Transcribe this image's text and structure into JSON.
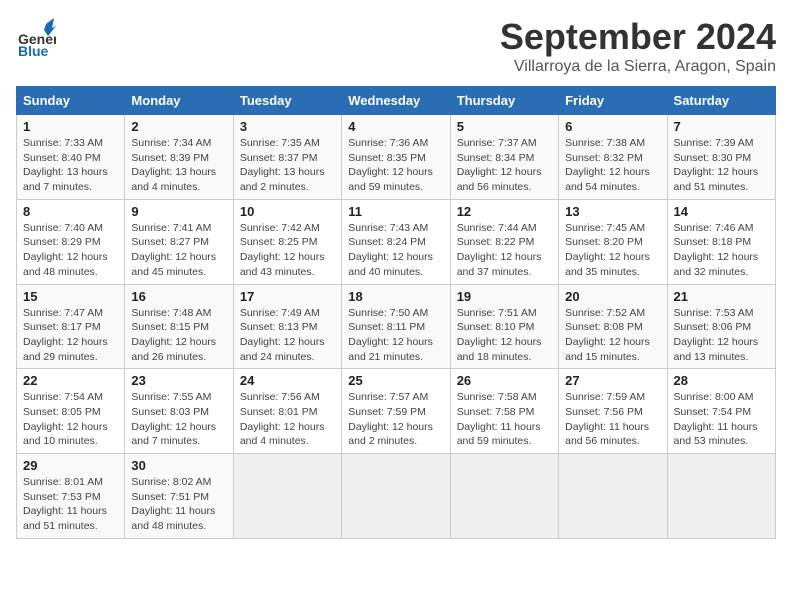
{
  "header": {
    "logo_line1": "General",
    "logo_line2": "Blue",
    "month_year": "September 2024",
    "location": "Villarroya de la Sierra, Aragon, Spain"
  },
  "days_of_week": [
    "Sunday",
    "Monday",
    "Tuesday",
    "Wednesday",
    "Thursday",
    "Friday",
    "Saturday"
  ],
  "weeks": [
    [
      {
        "day": 1,
        "sunrise": "7:33 AM",
        "sunset": "8:40 PM",
        "daylight": "13 hours and 7 minutes"
      },
      {
        "day": 2,
        "sunrise": "7:34 AM",
        "sunset": "8:39 PM",
        "daylight": "13 hours and 4 minutes"
      },
      {
        "day": 3,
        "sunrise": "7:35 AM",
        "sunset": "8:37 PM",
        "daylight": "13 hours and 2 minutes"
      },
      {
        "day": 4,
        "sunrise": "7:36 AM",
        "sunset": "8:35 PM",
        "daylight": "12 hours and 59 minutes"
      },
      {
        "day": 5,
        "sunrise": "7:37 AM",
        "sunset": "8:34 PM",
        "daylight": "12 hours and 56 minutes"
      },
      {
        "day": 6,
        "sunrise": "7:38 AM",
        "sunset": "8:32 PM",
        "daylight": "12 hours and 54 minutes"
      },
      {
        "day": 7,
        "sunrise": "7:39 AM",
        "sunset": "8:30 PM",
        "daylight": "12 hours and 51 minutes"
      }
    ],
    [
      {
        "day": 8,
        "sunrise": "7:40 AM",
        "sunset": "8:29 PM",
        "daylight": "12 hours and 48 minutes"
      },
      {
        "day": 9,
        "sunrise": "7:41 AM",
        "sunset": "8:27 PM",
        "daylight": "12 hours and 45 minutes"
      },
      {
        "day": 10,
        "sunrise": "7:42 AM",
        "sunset": "8:25 PM",
        "daylight": "12 hours and 43 minutes"
      },
      {
        "day": 11,
        "sunrise": "7:43 AM",
        "sunset": "8:24 PM",
        "daylight": "12 hours and 40 minutes"
      },
      {
        "day": 12,
        "sunrise": "7:44 AM",
        "sunset": "8:22 PM",
        "daylight": "12 hours and 37 minutes"
      },
      {
        "day": 13,
        "sunrise": "7:45 AM",
        "sunset": "8:20 PM",
        "daylight": "12 hours and 35 minutes"
      },
      {
        "day": 14,
        "sunrise": "7:46 AM",
        "sunset": "8:18 PM",
        "daylight": "12 hours and 32 minutes"
      }
    ],
    [
      {
        "day": 15,
        "sunrise": "7:47 AM",
        "sunset": "8:17 PM",
        "daylight": "12 hours and 29 minutes"
      },
      {
        "day": 16,
        "sunrise": "7:48 AM",
        "sunset": "8:15 PM",
        "daylight": "12 hours and 26 minutes"
      },
      {
        "day": 17,
        "sunrise": "7:49 AM",
        "sunset": "8:13 PM",
        "daylight": "12 hours and 24 minutes"
      },
      {
        "day": 18,
        "sunrise": "7:50 AM",
        "sunset": "8:11 PM",
        "daylight": "12 hours and 21 minutes"
      },
      {
        "day": 19,
        "sunrise": "7:51 AM",
        "sunset": "8:10 PM",
        "daylight": "12 hours and 18 minutes"
      },
      {
        "day": 20,
        "sunrise": "7:52 AM",
        "sunset": "8:08 PM",
        "daylight": "12 hours and 15 minutes"
      },
      {
        "day": 21,
        "sunrise": "7:53 AM",
        "sunset": "8:06 PM",
        "daylight": "12 hours and 13 minutes"
      }
    ],
    [
      {
        "day": 22,
        "sunrise": "7:54 AM",
        "sunset": "8:05 PM",
        "daylight": "12 hours and 10 minutes"
      },
      {
        "day": 23,
        "sunrise": "7:55 AM",
        "sunset": "8:03 PM",
        "daylight": "12 hours and 7 minutes"
      },
      {
        "day": 24,
        "sunrise": "7:56 AM",
        "sunset": "8:01 PM",
        "daylight": "12 hours and 4 minutes"
      },
      {
        "day": 25,
        "sunrise": "7:57 AM",
        "sunset": "7:59 PM",
        "daylight": "12 hours and 2 minutes"
      },
      {
        "day": 26,
        "sunrise": "7:58 AM",
        "sunset": "7:58 PM",
        "daylight": "11 hours and 59 minutes"
      },
      {
        "day": 27,
        "sunrise": "7:59 AM",
        "sunset": "7:56 PM",
        "daylight": "11 hours and 56 minutes"
      },
      {
        "day": 28,
        "sunrise": "8:00 AM",
        "sunset": "7:54 PM",
        "daylight": "11 hours and 53 minutes"
      }
    ],
    [
      {
        "day": 29,
        "sunrise": "8:01 AM",
        "sunset": "7:53 PM",
        "daylight": "11 hours and 51 minutes"
      },
      {
        "day": 30,
        "sunrise": "8:02 AM",
        "sunset": "7:51 PM",
        "daylight": "11 hours and 48 minutes"
      },
      null,
      null,
      null,
      null,
      null
    ]
  ]
}
